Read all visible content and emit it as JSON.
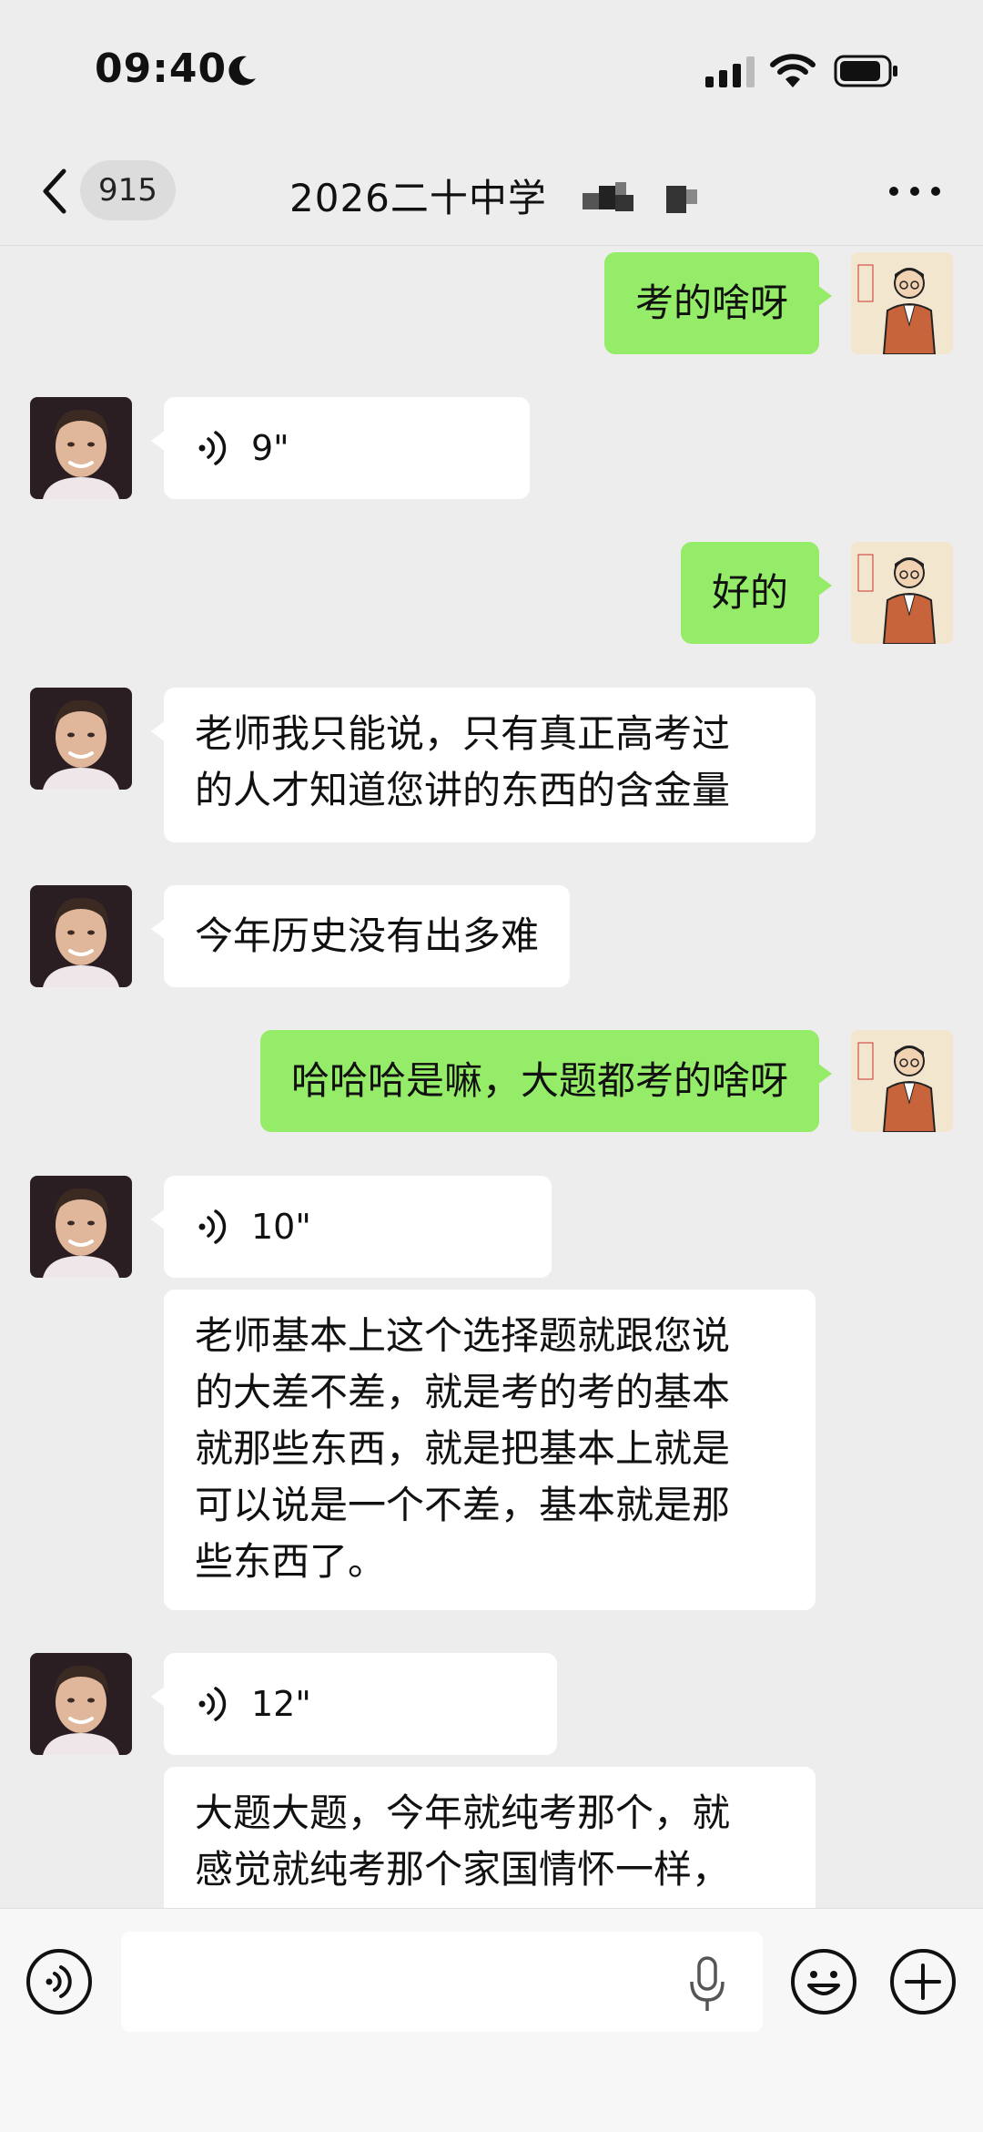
{
  "status_bar": {
    "time": "09:40"
  },
  "nav": {
    "unread_count": "915",
    "title": "2026二十中学"
  },
  "messages": [
    {
      "side": "right",
      "type": "text",
      "text": "考的啥呀"
    },
    {
      "side": "left",
      "type": "voice",
      "duration": "9\""
    },
    {
      "side": "right",
      "type": "text",
      "text": "好的"
    },
    {
      "side": "left",
      "type": "text",
      "lines": [
        "老师我只能说，只有真正高考过",
        "的人才知道您讲的东西的含金量"
      ]
    },
    {
      "side": "left",
      "type": "text",
      "text": "今年历史没有出多难"
    },
    {
      "side": "right",
      "type": "text",
      "text": "哈哈哈是嘛，大题都考的啥呀"
    },
    {
      "side": "left",
      "type": "voice",
      "duration": "10\""
    },
    {
      "side": "left",
      "type": "text",
      "lines": [
        "老师基本上这个选择题就跟您说",
        "的大差不差，就是考的考的基本",
        "就那些东西，就是把基本上就是",
        "可以说是一个不差，基本就是那",
        "些东西了。"
      ]
    },
    {
      "side": "left",
      "type": "voice",
      "duration": "12\""
    },
    {
      "side": "left",
      "type": "text",
      "lines": [
        "大题大题，今年就纯考那个，就",
        "感觉就纯考那个家国情怀一样，"
      ]
    }
  ],
  "teacher_avatar_seal": "史老师",
  "colors": {
    "outgoing_bubble": "#95ec69",
    "incoming_bubble": "#ffffff",
    "chat_background": "#ededed"
  }
}
